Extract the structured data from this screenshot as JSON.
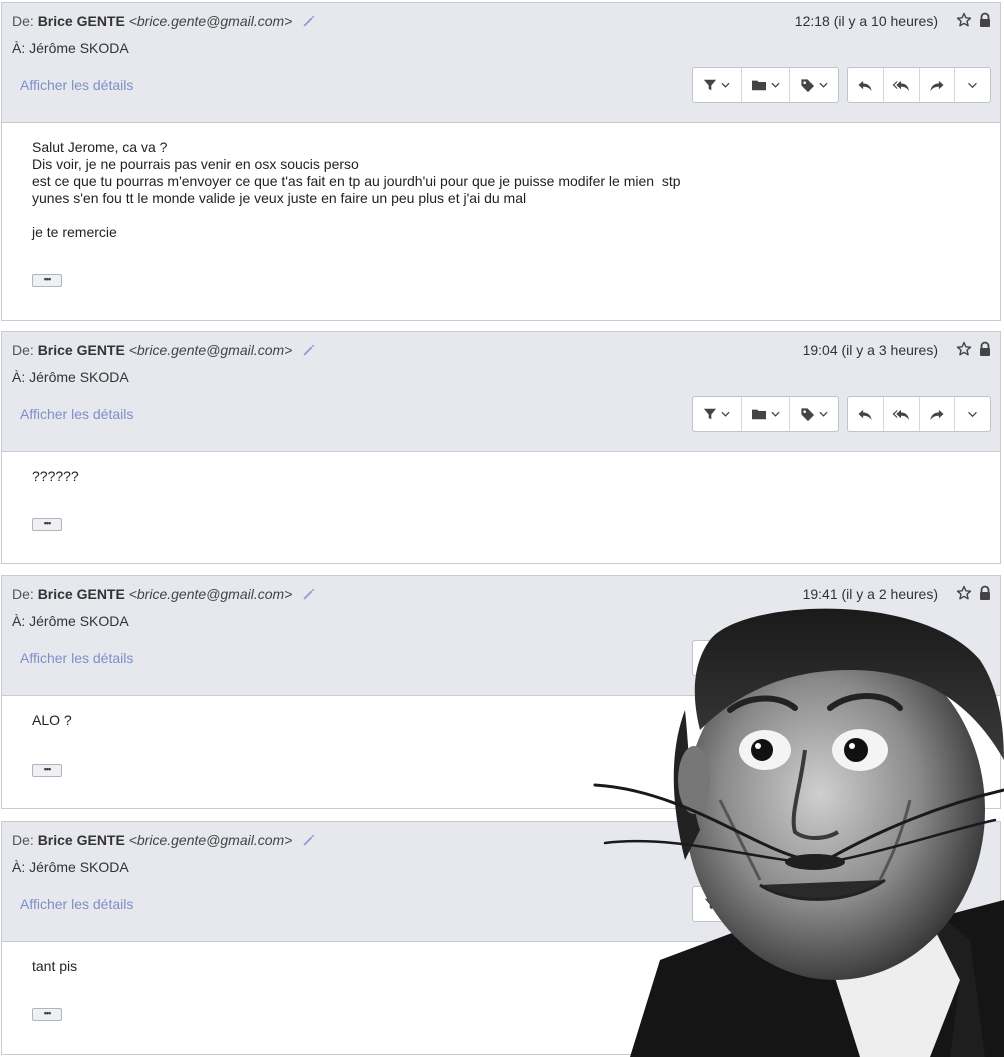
{
  "common": {
    "from_prefix": "De:",
    "from_name": "Brice GENTE",
    "from_email": "<brice.gente@gmail.com>",
    "to_line": "À: Jérôme SKODA",
    "details_link": "Afficher les détails"
  },
  "messages": [
    {
      "time": "12:18 (il y a 10 heures)",
      "body": [
        "Salut Jerome, ca va ?",
        "Dis voir, je ne pourrais pas venir en osx soucis perso",
        "est ce que tu pourras m'envoyer ce que t'as fait en tp au jourdh'ui pour que je puisse modifer le mien  stp",
        "yunes s'en fou tt le monde valide je veux juste en faire un peu plus et j'ai du mal",
        "",
        "je te remercie"
      ]
    },
    {
      "time": "19:04 (il y a 3 heures)",
      "body": [
        "??????"
      ]
    },
    {
      "time": "19:41 (il y a 2 heures)",
      "body": [
        "ALO ?"
      ]
    },
    {
      "time": "",
      "body": [
        "tant pis"
      ]
    }
  ],
  "icons": {
    "edit": "pencil-icon",
    "star": "star-icon",
    "lock": "lock-icon",
    "filter": "filter-icon",
    "move": "folder-icon",
    "label": "tag-icon",
    "reply": "reply-icon",
    "reply_all": "reply-all-icon",
    "forward": "forward-icon",
    "more": "chevron-down-icon"
  },
  "colors": {
    "header_bg": "#e6e8ee",
    "link": "#7f8fc8",
    "border": "#c8cbd4"
  }
}
